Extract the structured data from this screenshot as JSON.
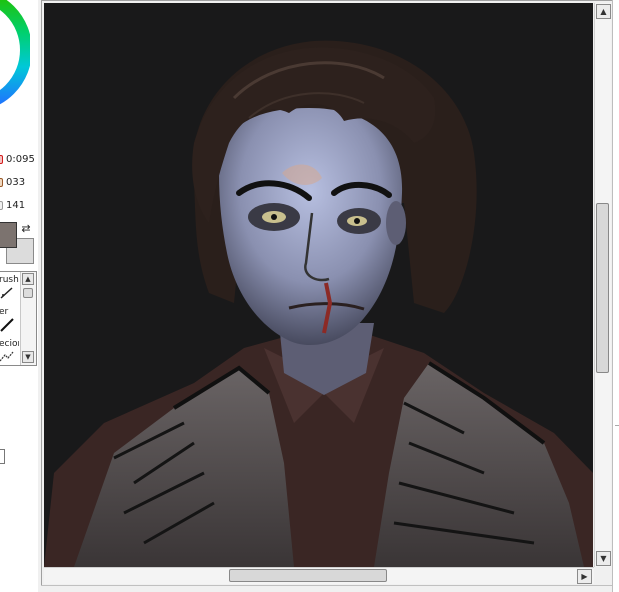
{
  "color_panel": {
    "sliders": [
      {
        "value": "0:095",
        "color": "#d21b1b"
      },
      {
        "value": "033",
        "color": "#9a5a2a"
      },
      {
        "value": "141",
        "color": "#b8b8b8"
      }
    ],
    "main_color": "#7c736f",
    "sub_color": "#dcdcdc"
  },
  "brush_list": {
    "items": [
      {
        "label": "rush"
      },
      {
        "label": "er"
      },
      {
        "label": "ecior"
      }
    ]
  },
  "canvas": {
    "background": "#19191a"
  }
}
